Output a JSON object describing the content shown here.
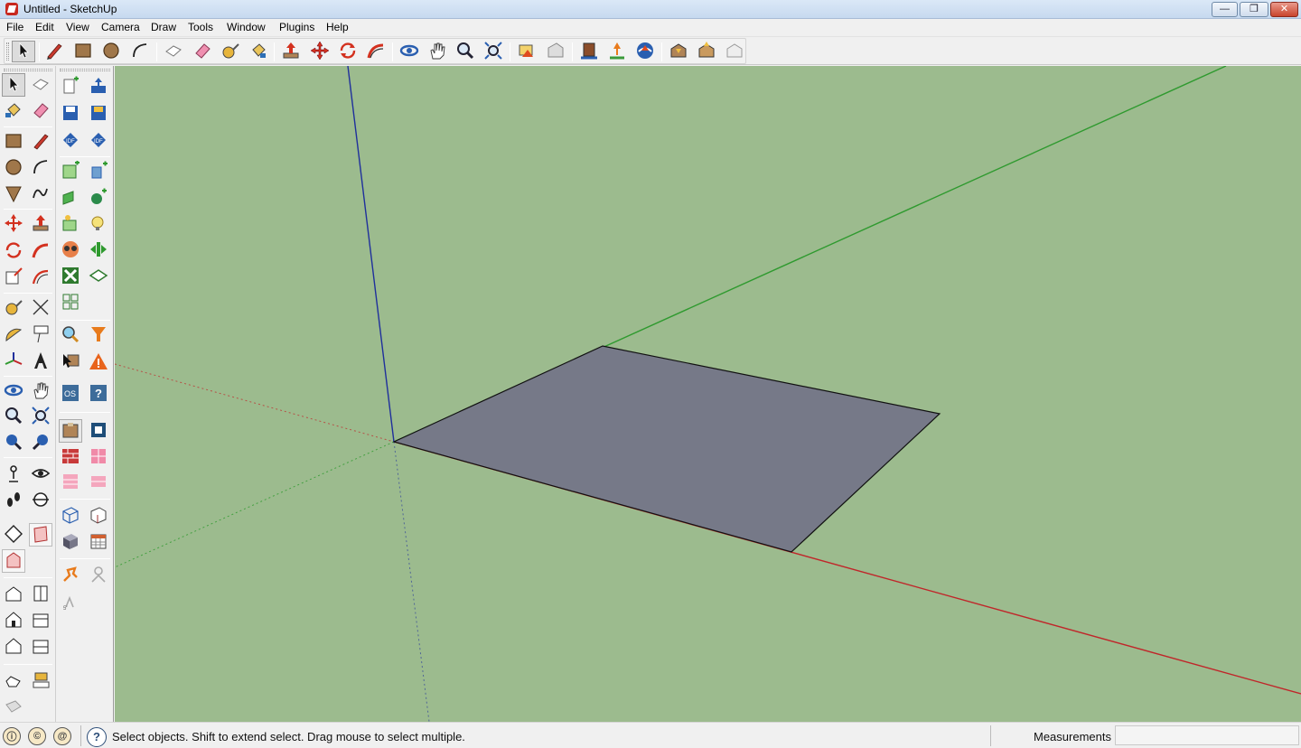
{
  "window": {
    "title": "Untitled - SketchUp",
    "controls": {
      "minimize": "—",
      "maximize": "❐",
      "close": "✕"
    }
  },
  "menu": {
    "items": [
      "File",
      "Edit",
      "View",
      "Camera",
      "Draw",
      "Tools",
      "Window",
      "Plugins",
      "Help"
    ]
  },
  "toolbar": {
    "tools": [
      "select-icon",
      "pencil-line-icon",
      "rectangle-icon",
      "circle-icon",
      "arc-icon",
      "make-component-icon",
      "eraser-icon",
      "tape-measure-icon",
      "paint-bucket-icon",
      "push-pull-icon",
      "move-icon",
      "rotate-icon",
      "follow-me-icon",
      "orbit-icon",
      "pan-icon",
      "zoom-icon",
      "zoom-extents-icon",
      "previous-view-icon",
      "next-view-icon",
      "get-models-icon",
      "share-model-icon",
      "google-earth-icon",
      "get-current-view-icon",
      "toggle-terrain-icon",
      "place-model-icon"
    ]
  },
  "colors": {
    "viewport_bg": "#9cbb8e",
    "face": "#767988",
    "axis_red": "#c0262a",
    "axis_green": "#2f9a2f",
    "axis_blue": "#1f2f9c"
  },
  "status": {
    "hint": "Select objects. Shift to extend select. Drag mouse to select multiple.",
    "help_glyph": "?",
    "measurements_label": "Measurements",
    "measurements_value": ""
  }
}
